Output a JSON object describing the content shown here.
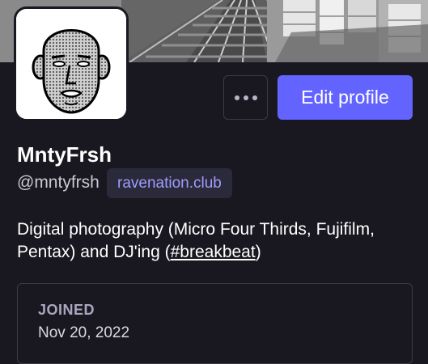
{
  "profile": {
    "display_name": "MntyFrsh",
    "username": "@mntyfrsh",
    "domain": "ravenation.club",
    "bio_text": "Digital photography (Micro Four Thirds, Fujifilm, Pentax) and DJ'ing (",
    "bio_hashtag": "#breakbeat",
    "bio_end": ")"
  },
  "actions": {
    "more_icon": "more-horizontal-icon",
    "edit_label": "Edit profile"
  },
  "joined": {
    "label": "JOINED",
    "date": "Nov 20, 2022"
  },
  "colors": {
    "background": "#191820",
    "accent": "#6364ff",
    "badge_text": "#9e9cff",
    "border": "#3b3a47"
  }
}
